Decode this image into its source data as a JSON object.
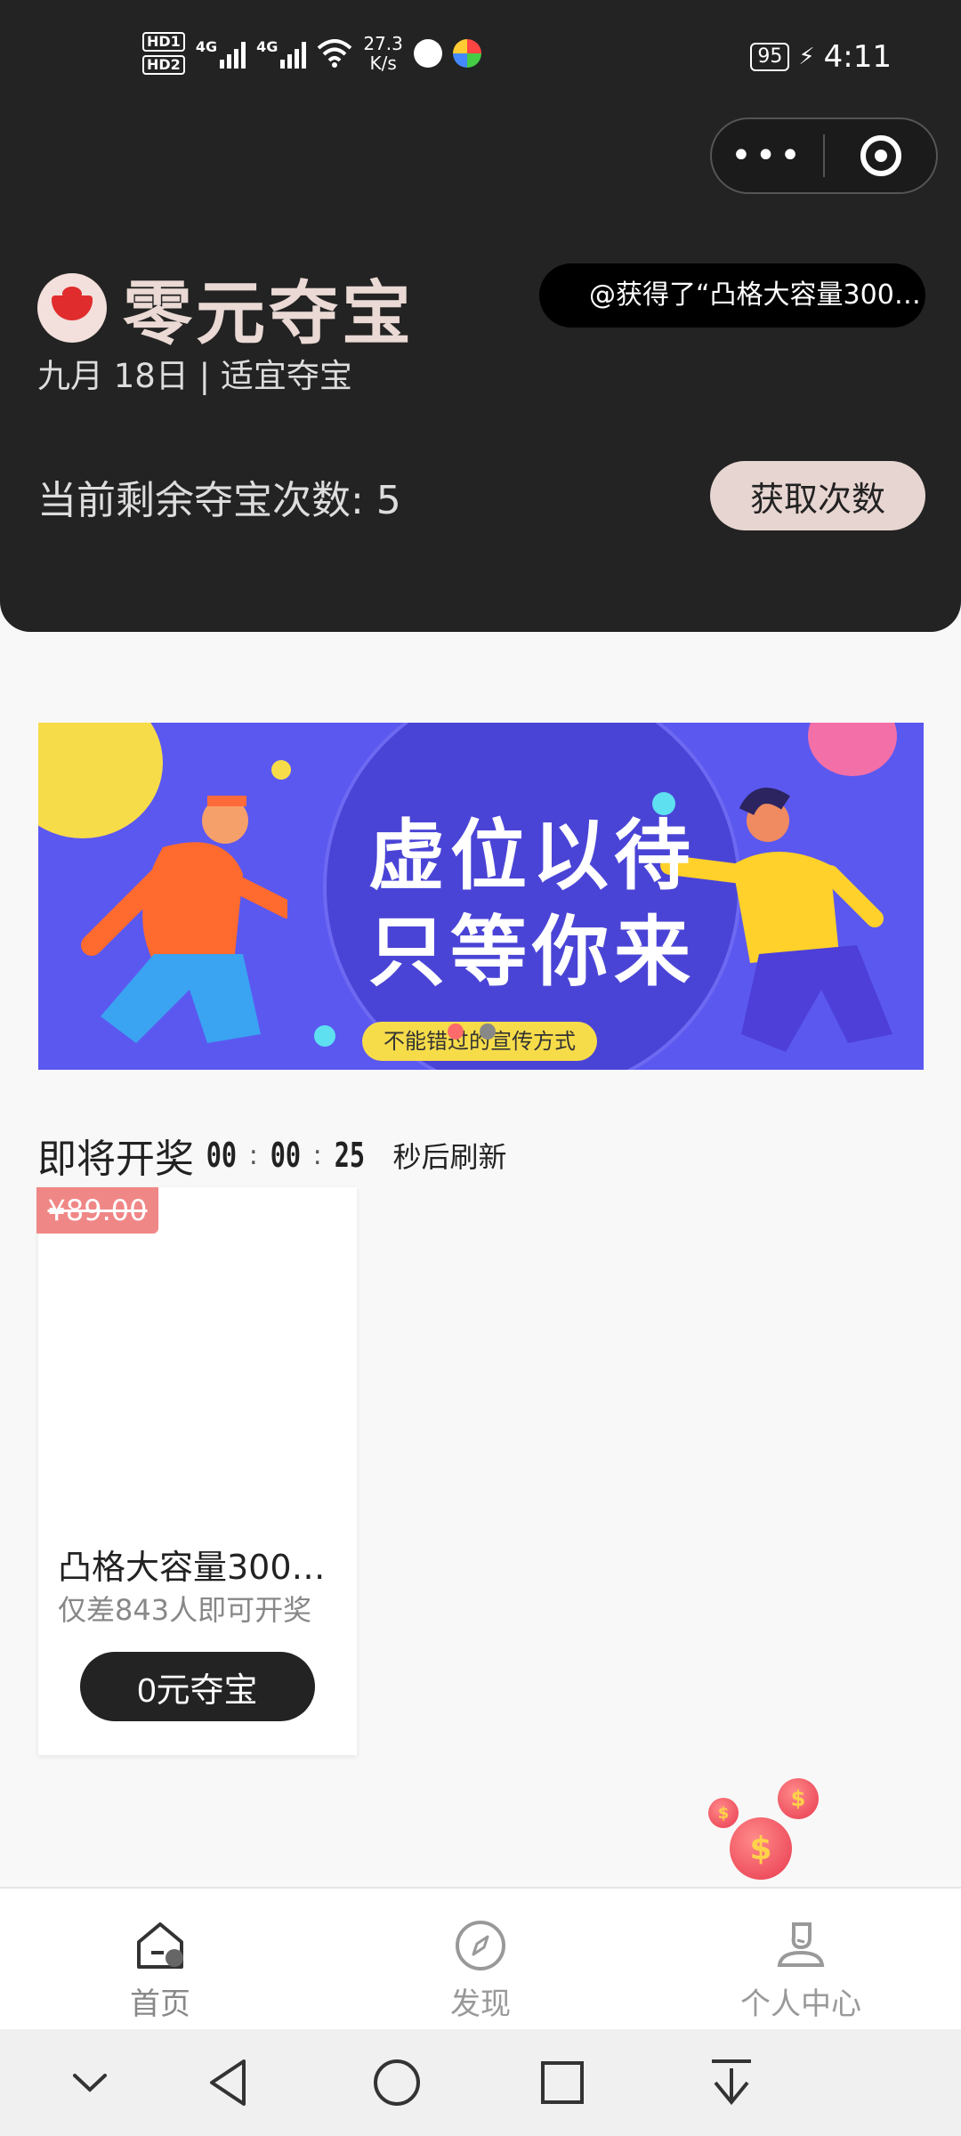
{
  "status_bar": {
    "hd1": "HD1",
    "hd2": "HD2",
    "net1": "4G",
    "net2": "4G",
    "speed_value": "27.3",
    "speed_unit": "K/s",
    "battery": "95",
    "time": "4:11"
  },
  "capsule": {
    "more_label": "•••"
  },
  "header": {
    "title": "零元夺宝",
    "date_line": "九月 18日 | 适宜夺宝",
    "ticker": "@获得了“凸格大容量3000...",
    "remaining_label": "当前剩余夺宝次数: 5",
    "get_button": "获取次数"
  },
  "banner": {
    "line1": "虚位以待",
    "line2": "只等你来",
    "pill": "不能错过的宣传方式"
  },
  "countdown": {
    "prefix": "即将开奖",
    "hours": "00",
    "sep": ":",
    "minutes": "00",
    "seconds": "25",
    "suffix": "秒后刷新"
  },
  "product": {
    "original_price": "¥89.00",
    "name": "凸格大容量3000...",
    "subtitle": "仅差843人即可开奖",
    "button": "0元夺宝"
  },
  "bottom_nav": {
    "items": [
      {
        "label": "首页",
        "icon": "home-icon"
      },
      {
        "label": "发现",
        "icon": "compass-icon"
      },
      {
        "label": "个人中心",
        "icon": "person-icon"
      }
    ]
  },
  "colors": {
    "header_bg": "#232323",
    "accent_pink": "#e7d5d1",
    "price_tag": "#f08787",
    "banner_bg": "#5b58f0"
  }
}
